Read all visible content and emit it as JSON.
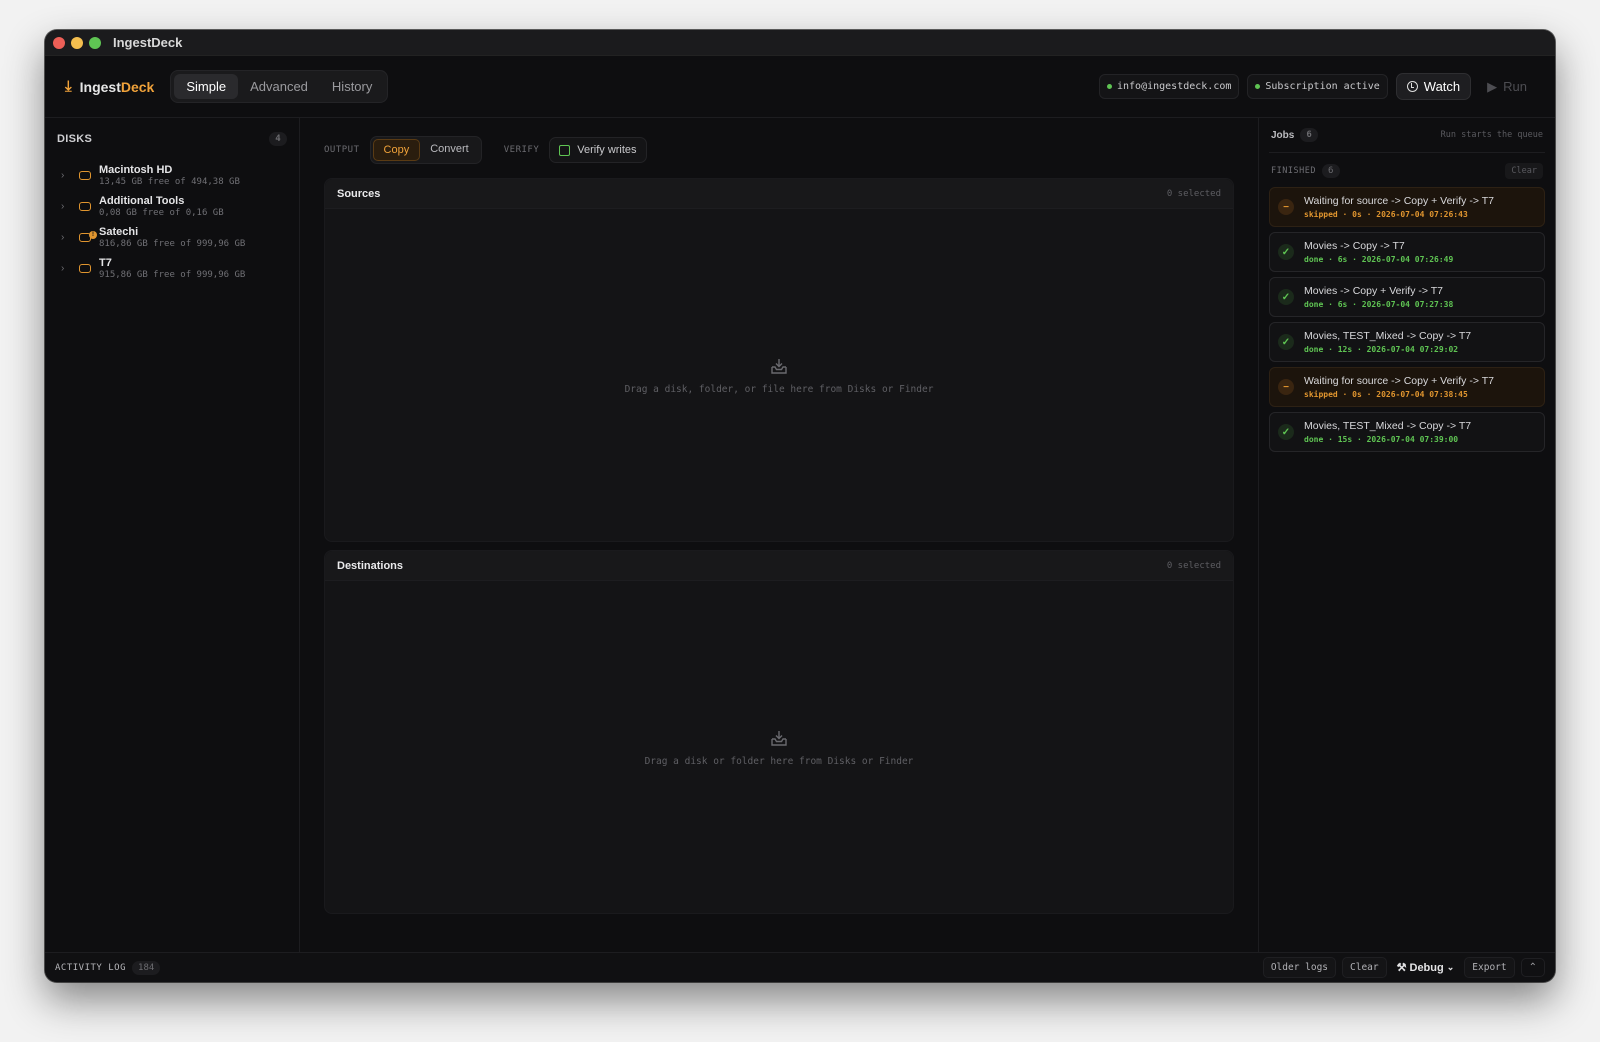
{
  "window": {
    "title": "IngestDeck"
  },
  "brand": {
    "name_a": "Ingest",
    "name_b": "Deck",
    "accent": "#f0a23a"
  },
  "mode_tabs": [
    {
      "label": "Simple"
    },
    {
      "label": "Advanced"
    },
    {
      "label": "History"
    }
  ],
  "header": {
    "email": "info@ingestdeck.com",
    "subscription": "Subscription active",
    "watch_label": "Watch",
    "run_label": "Run"
  },
  "sidebar": {
    "title": "DISKS",
    "count": "4",
    "disks": [
      {
        "name": "Macintosh HD",
        "sub": "13,45 GB free of 494,38 GB"
      },
      {
        "name": "Additional Tools",
        "sub": "0,08 GB free of 0,16 GB"
      },
      {
        "name": "Satechi",
        "sub": "816,86 GB free of 999,96 GB"
      },
      {
        "name": "T7",
        "sub": "915,86 GB free of 999,96 GB"
      }
    ]
  },
  "options": {
    "output_label": "OUTPUT",
    "copy_label": "Copy",
    "convert_label": "Convert",
    "verify_label": "VERIFY",
    "verify_writes_label": "Verify writes"
  },
  "sources": {
    "title": "Sources",
    "count": "0 selected",
    "hint": "Drag a disk, folder, or file here from Disks or Finder"
  },
  "destinations": {
    "title": "Destinations",
    "count": "0 selected",
    "hint": "Drag a disk or folder here from Disks or Finder"
  },
  "jobs": {
    "title": "Jobs",
    "count": "6",
    "hint": "Run starts the queue",
    "finished_label": "FINISHED",
    "finished_count": "6",
    "clear_label": "Clear",
    "items": [
      {
        "title": "Waiting for source -> Copy + Verify -> T7",
        "sub": "skipped · 0s · 2026-07-04 07:26:43",
        "status": "skipped"
      },
      {
        "title": "Movies -> Copy -> T7",
        "sub": "done · 6s · 2026-07-04 07:26:49",
        "status": "done"
      },
      {
        "title": "Movies -> Copy + Verify -> T7",
        "sub": "done · 6s · 2026-07-04 07:27:38",
        "status": "done"
      },
      {
        "title": "Movies, TEST_Mixed -> Copy -> T7",
        "sub": "done · 12s · 2026-07-04 07:29:02",
        "status": "done"
      },
      {
        "title": "Waiting for source -> Copy + Verify -> T7",
        "sub": "skipped · 0s · 2026-07-04 07:38:45",
        "status": "skipped"
      },
      {
        "title": "Movies, TEST_Mixed -> Copy -> T7",
        "sub": "done · 15s · 2026-07-04 07:39:00",
        "status": "done"
      }
    ]
  },
  "statusbar": {
    "log_label": "ACTIVITY LOG",
    "log_count": "184",
    "older_logs_label": "Older logs",
    "clear_label": "Clear",
    "debug_label": "Debug",
    "export_label": "Export"
  }
}
